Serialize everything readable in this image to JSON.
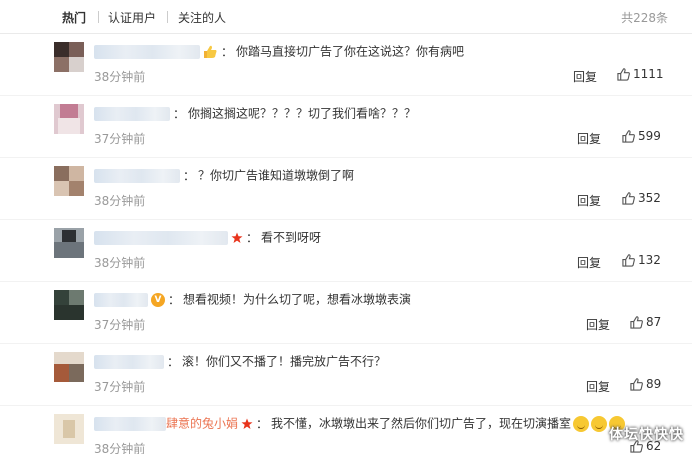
{
  "tabs": [
    {
      "label": "热门",
      "active": true
    },
    {
      "label": "认证用户",
      "active": false
    },
    {
      "label": "关注的人",
      "active": false
    }
  ],
  "total": "共228条",
  "reply_label": "回复",
  "comments": [
    {
      "username": "",
      "text": "你踏马直接切广告了你在这说这？你有病吧",
      "time": "38分钟前",
      "likes": "1111",
      "badge": "hand-icon"
    },
    {
      "username": "",
      "text": "你搁这搁这呢？？？？切了我们看啥？？？",
      "time": "37分钟前",
      "likes": "599",
      "badge": ""
    },
    {
      "username": "",
      "text": "？你切广告谁知道墩墩倒了啊",
      "time": "38分钟前",
      "likes": "352",
      "badge": ""
    },
    {
      "username": "",
      "text": "看不到呀呀",
      "time": "38分钟前",
      "likes": "132",
      "badge": "star-icon"
    },
    {
      "username": "",
      "text": "想看视频！为什么切了呢，想看冰墩墩表演",
      "time": "37分钟前",
      "likes": "87",
      "badge": "verified-icon"
    },
    {
      "username": "",
      "text": "滚！你们又不播了！播完放广告不行？",
      "time": "37分钟前",
      "likes": "89",
      "badge": ""
    },
    {
      "username": "肆意的兔小娟",
      "text": "我不懂，冰墩墩出来了然后你们切广告了，现在切演播室",
      "time": "38分钟前",
      "likes": "62",
      "badge": "star-icon"
    }
  ],
  "watermark": "体坛快快快",
  "colors": {
    "username": "#eb7350",
    "muted": "#999999",
    "badge_v": "#f5a623",
    "star": "#e8341c"
  }
}
